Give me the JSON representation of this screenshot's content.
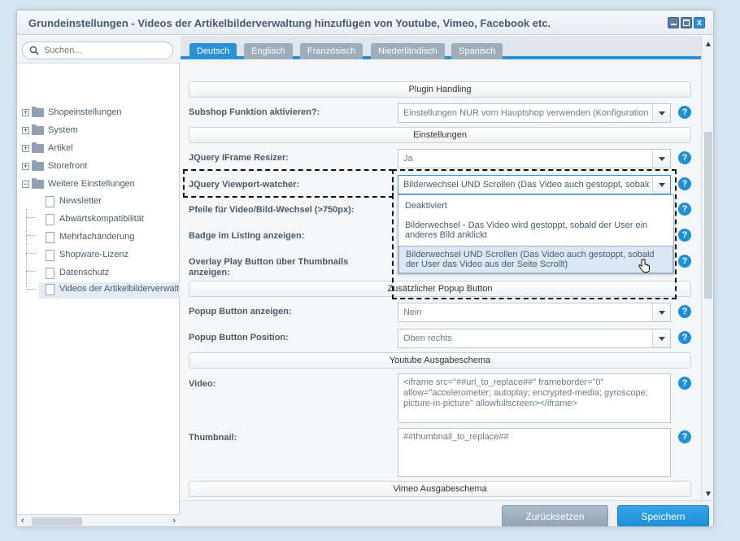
{
  "window": {
    "title": "Grundeinstellungen - Videos der Artikelbilderverwaltung hinzufügen von Youtube, Vimeo, Facebook etc.",
    "close_label": "x"
  },
  "sidebar": {
    "search_placeholder": "Suchen...",
    "tree": [
      {
        "label": "Shopeinstellungen",
        "expander": "+"
      },
      {
        "label": "System",
        "expander": "+"
      },
      {
        "label": "Artikel",
        "expander": "+"
      },
      {
        "label": "Storefront",
        "expander": "+"
      },
      {
        "label": "Weitere Einstellungen",
        "expander": "−"
      },
      {
        "label": "Newsletter"
      },
      {
        "label": "Abwärtskompatibilität"
      },
      {
        "label": "Mehrfachänderung"
      },
      {
        "label": "Shopware-Lizenz"
      },
      {
        "label": "Datenschutz"
      },
      {
        "label": "Videos der Artikelbilderverwaltung"
      }
    ],
    "scroll_left": "‹",
    "scroll_right": "›"
  },
  "tabs": [
    {
      "label": "Deutsch",
      "active": true
    },
    {
      "label": "Englisch"
    },
    {
      "label": "Französisch"
    },
    {
      "label": "Niederländisch"
    },
    {
      "label": "Spanisch"
    }
  ],
  "form": {
    "section_plugin": "Plugin Handling",
    "subshop_label": "Subshop Funktion aktivieren?:",
    "subshop_value": "Einstellungen NUR vom Hauptshop verwenden (Konfigurationen",
    "section_settings": "Einstellungen",
    "iframe_label": "JQuery IFrame Resizer:",
    "iframe_value": "Ja",
    "viewport_label": "JQuery Viewport-watcher:",
    "viewport_value": "Bilderwechsel UND Scrollen (Das Video auch gestoppt, sobald",
    "viewport_options": [
      "Deaktiviert",
      "Bilderwechsel - Das Video wird gestoppt, sobald der User ein anderes Bild anklickt",
      "Bilderwechsel UND Scrollen (Das Video auch gestoppt, sobald der User das Video aus der Seite Scrollt)"
    ],
    "arrows_label": "Pfeile für Video/Bild-Wechsel (>750px):",
    "badge_label": "Badge im Listing anzeigen:",
    "overlay_label": "Overlay Play Button über Thumbnails anzeigen:",
    "section_popup": "Zusätzlicher Popup Button",
    "popup_show_label": "Popup Button anzeigen:",
    "popup_show_value": "Nein",
    "popup_pos_label": "Popup Button Position:",
    "popup_pos_value": "Oben rechts",
    "section_youtube": "Youtube Ausgabeschema",
    "video_label": "Video:",
    "video_value": "<iframe src=\"##url_to_replace##\" frameborder=\"0\" allow=\"accelerometer; autoplay; encrypted-media; gyroscope; picture-in-picture\" allowfullscreen></iframe>",
    "thumb_label": "Thumbnail:",
    "thumb_value": "##thumbnail_to_replace##",
    "section_vimeo": "Vimeo Ausgabeschema",
    "help_label": "?"
  },
  "scroll": {
    "up": "▲",
    "down": "▼"
  },
  "footer": {
    "reset_label": "Zurücksetzen",
    "save_label": "Speichern"
  },
  "colors": {
    "accent": "#2a91d6",
    "background": "#d6e4ef",
    "button_secondary": "#9dadbc"
  }
}
